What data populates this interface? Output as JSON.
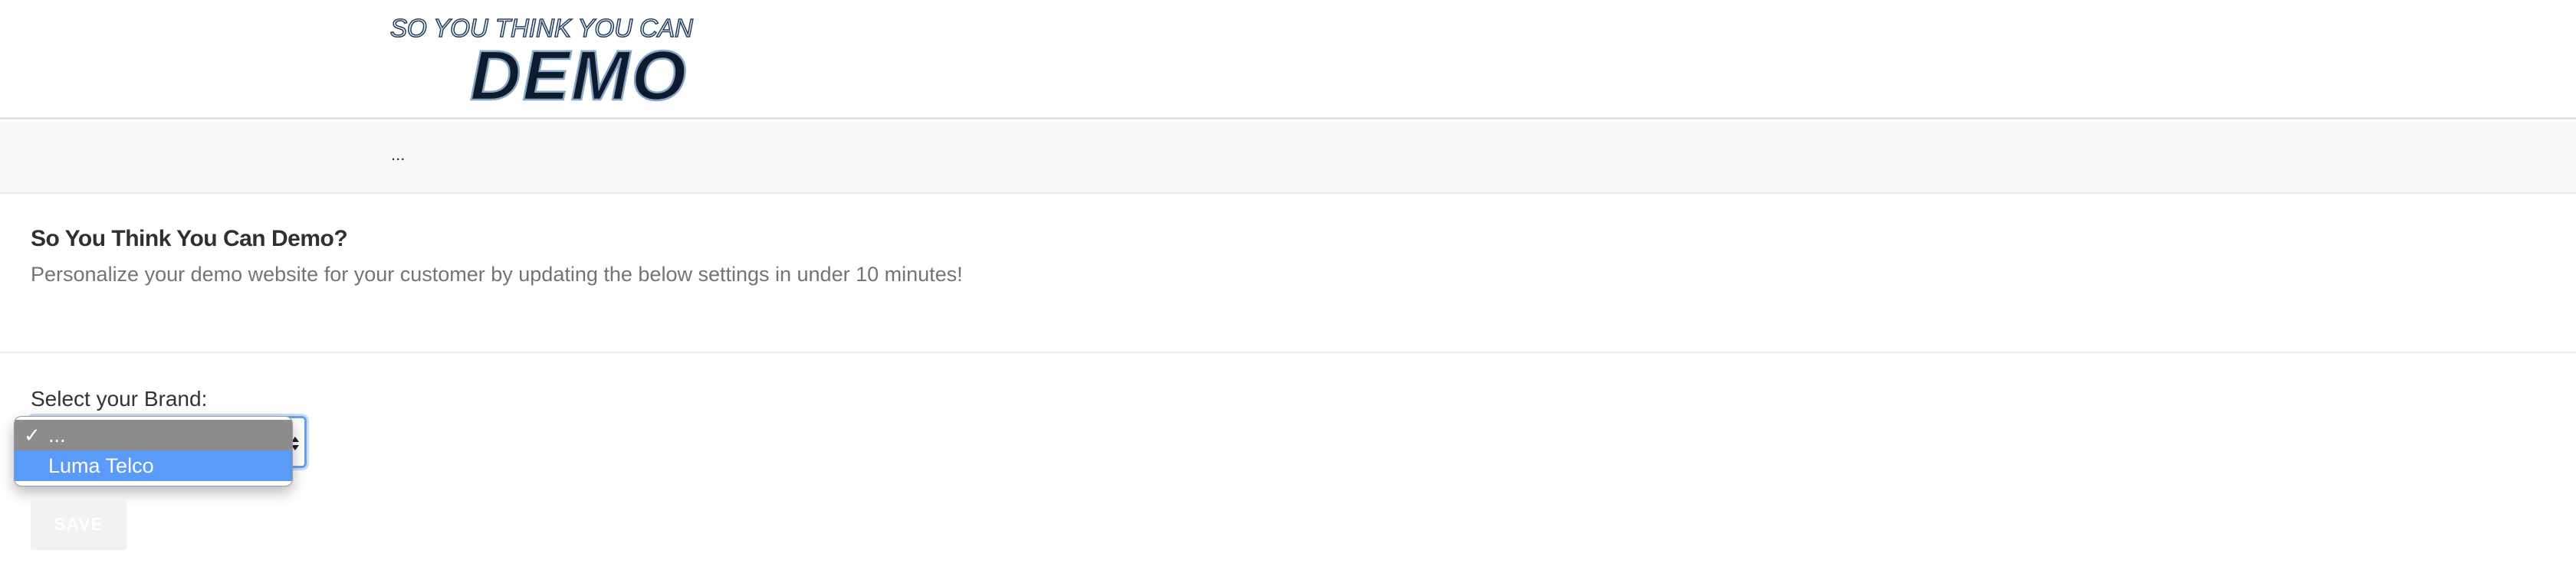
{
  "header": {
    "logo_top_line": "SO YOU THINK YOU CAN",
    "logo_main_word": "DEMO"
  },
  "breadcrumb": {
    "text": "..."
  },
  "intro": {
    "title": "So You Think You Can Demo?",
    "description": "Personalize your demo website for your customer by updating the below settings in under 10 minutes!"
  },
  "form": {
    "brand_label": "Select your Brand:",
    "brand_select": {
      "selected_value": "...",
      "options": [
        {
          "label": "...",
          "selected": true
        },
        {
          "label": "Luma Telco",
          "highlighted": true
        }
      ]
    },
    "save_label": "SAVE"
  },
  "colors": {
    "focus_ring": "#6b9fe8",
    "option_highlight": "#5b9af8",
    "option_selected": "#8c8c8c",
    "logo_dark": "#0d1b2e",
    "logo_outline": "#4a6a8f"
  }
}
